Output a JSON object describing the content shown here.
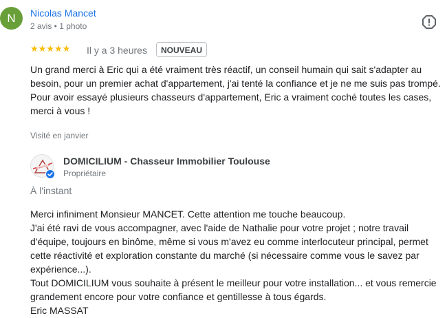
{
  "review": {
    "avatar_letter": "N",
    "avatar_color": "#689f38",
    "reviewer_name": "Nicolas Mancet",
    "reviewer_meta": "2 avis • 1 photo",
    "stars": "★★★★★",
    "rating": 5,
    "time_ago": "Il y a 3 heures",
    "badge": "NOUVEAU",
    "text": "Un grand merci à Eric qui a été vraiment très réactif, un conseil humain qui sait s'adapter au besoin, pour un premier achat d'appartement, j'ai tenté la confiance et je ne me suis pas trompé. Pour avoir essayé plusieurs chasseurs d'appartement, Eric a vraiment coché toutes les cases, merci à vous !",
    "visited": "Visité en janvier",
    "report_icon": "report-flag-icon"
  },
  "owner_reply": {
    "owner_name": "DOMICILIUM - Chasseur Immobilier Toulouse",
    "owner_role": "Propriétaire",
    "reply_time": "À l'instant",
    "logo_text": "DOMICILIUM",
    "verified_icon": "verified-check-icon",
    "lines": [
      "Merci infiniment Monsieur MANCET. Cette attention me touche beaucoup.",
      "J'ai été ravi de vous accompagner, avec l'aide de Nathalie pour votre projet ; notre travail d'équipe, toujours en binôme, même si vous m'avez eu comme interlocuteur principal, permet cette réactivité et exploration constante du marché (si nécessaire comme vous le savez par expérience...).",
      "Tout DOMICILIUM vous souhaite à présent le meilleur pour votre installation... et vous remercie grandement encore pour votre confiance et gentillesse à tous égards.",
      "Eric MASSAT"
    ]
  },
  "colors": {
    "link": "#1a73e8",
    "star": "#fbbc04",
    "muted": "#70757a",
    "verified": "#1a73e8"
  }
}
